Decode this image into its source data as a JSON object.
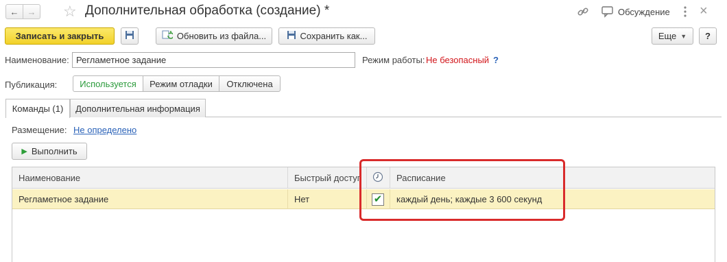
{
  "window": {
    "title": "Дополнительная обработка (создание) *",
    "discussion_label": "Обсуждение"
  },
  "toolbar": {
    "save_close": "Записать и закрыть",
    "load_file": "Обновить из файла...",
    "save_as": "Сохранить как...",
    "more": "Еще",
    "help": "?"
  },
  "form": {
    "name_label": "Наименование:",
    "name_value": "Регламетное задание",
    "mode_label": "Режим работы:",
    "mode_value": "Не безопасный",
    "mode_help": "?",
    "publication_label": "Публикация:",
    "publication_options": [
      "Используется",
      "Режим отладки",
      "Отключена"
    ],
    "publication_selected": "Используется"
  },
  "tabs": [
    {
      "label": "Команды (1)",
      "active": true
    },
    {
      "label": "Дополнительная информация",
      "active": false
    }
  ],
  "commands": {
    "placement_label": "Размещение:",
    "placement_value": "Не определено",
    "run_button": "Выполнить",
    "columns": [
      "Наименование",
      "Быстрый доступ",
      "",
      "Расписание"
    ],
    "rows": [
      {
        "name": "Регламетное задание",
        "quick_access": "Нет",
        "scheduled": true,
        "schedule": "каждый день; каждые 3 600 секунд"
      }
    ]
  },
  "colors": {
    "primary_button": "#f2d22a",
    "selected_row": "#fbf2c2",
    "highlight_frame": "#d92b2b",
    "danger_text": "#d2161b",
    "link": "#2a62b8",
    "active_option": "#2a9a3a"
  },
  "icons": [
    "back-arrow-icon",
    "forward-arrow-icon",
    "star-icon",
    "link-icon",
    "discussion-icon",
    "more-vert-icon",
    "close-icon",
    "floppy-disk-icon",
    "reload-file-icon",
    "save-as-icon",
    "play-icon",
    "clock-icon",
    "checkbox-checked-icon"
  ]
}
